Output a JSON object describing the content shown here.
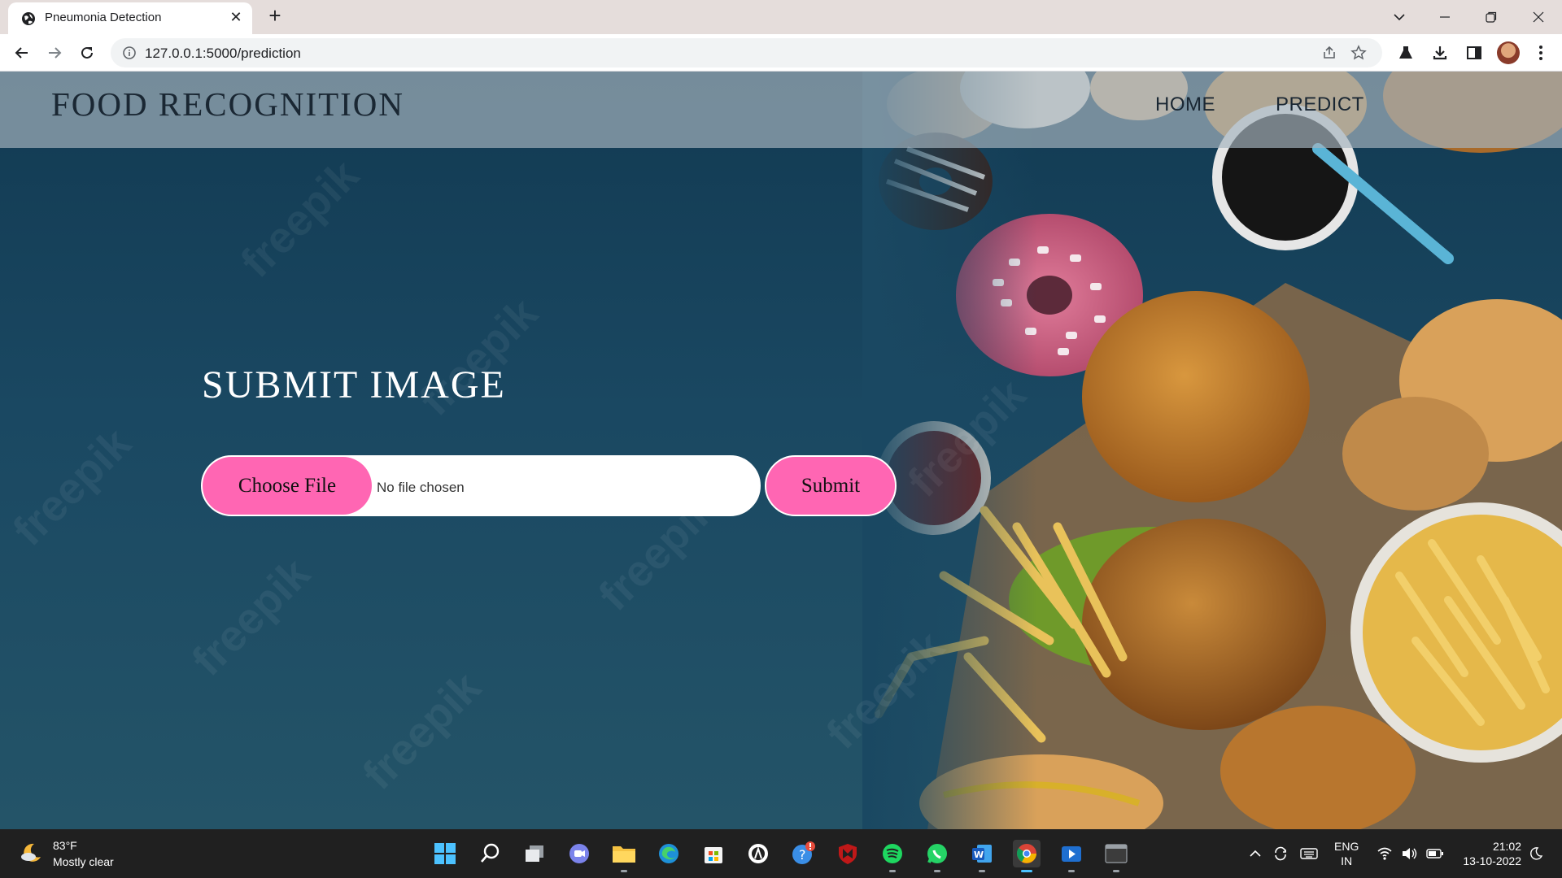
{
  "browser": {
    "tab_title": "Pneumonia Detection",
    "url": "127.0.0.1:5000/prediction"
  },
  "page": {
    "brand": "FOOD RECOGNITION",
    "nav": {
      "home": "HOME",
      "predict": "PREDICT"
    },
    "heading": "SUBMIT IMAGE",
    "choose_file_label": "Choose File",
    "no_file_text": "No file chosen",
    "submit_label": "Submit",
    "watermark": "freepik",
    "accent_color": "#ff66b3"
  },
  "taskbar": {
    "weather_temp": "83°F",
    "weather_desc": "Mostly clear",
    "lang_primary": "ENG",
    "lang_secondary": "IN",
    "time": "21:02",
    "date": "13-10-2022"
  }
}
